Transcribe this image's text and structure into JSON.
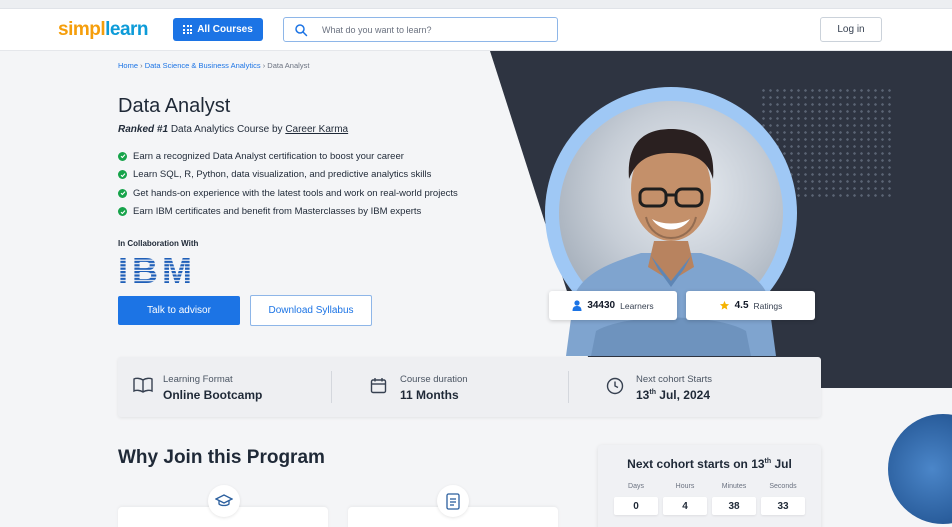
{
  "nav": {
    "logo_part1": "simpl",
    "logo_part2": "learn",
    "all_courses": "All Courses",
    "search_placeholder": "What do you want to learn?",
    "login": "Log in"
  },
  "breadcrumb": {
    "home": "Home",
    "category": "Data Science & Business Analytics",
    "current": "Data Analyst",
    "separator": "›"
  },
  "course": {
    "title": "Data Analyst",
    "ranked_bold": "Ranked #1",
    "ranked_rest": "Data Analytics Course by",
    "ranked_source": "Career Karma",
    "bullets": [
      "Earn a recognized Data Analyst certification to boost your career",
      "Learn SQL, R, Python, data visualization, and predictive analytics skills",
      "Get hands-on experience with the latest tools and work on real-world projects",
      "Earn IBM certificates and benefit from Masterclasses by IBM experts"
    ],
    "collab_label": "In Collaboration With",
    "partner_logo": "IBM",
    "cta_primary": "Talk to advisor",
    "cta_secondary": "Download Syllabus"
  },
  "stats": {
    "learners_value": "34430",
    "learners_label": "Learners",
    "rating_value": "4.5",
    "rating_label": "Ratings",
    "rating_star_color": "#f5b301"
  },
  "info_bar": {
    "format_label": "Learning Format",
    "format_value": "Online Bootcamp",
    "duration_label": "Course duration",
    "duration_value": "11 Months",
    "cohort_label": "Next cohort Starts",
    "cohort_day": "13",
    "cohort_suffix": "th",
    "cohort_rest": " Jul, 2024"
  },
  "why_join": {
    "heading": "Why Join this Program"
  },
  "countdown": {
    "title_prefix": "Next cohort starts on 13",
    "title_suffix": "th",
    "title_rest": " Jul",
    "units": [
      {
        "label": "Days",
        "value": "0"
      },
      {
        "label": "Hours",
        "value": "4"
      },
      {
        "label": "Minutes",
        "value": "38"
      },
      {
        "label": "Seconds",
        "value": "33"
      }
    ]
  },
  "colors": {
    "brand_blue": "#1c74e5",
    "dark_panel": "#2e3441",
    "check_green": "#16a34a",
    "logo_orange": "#f59e0b",
    "logo_blue": "#0d9bd8"
  }
}
